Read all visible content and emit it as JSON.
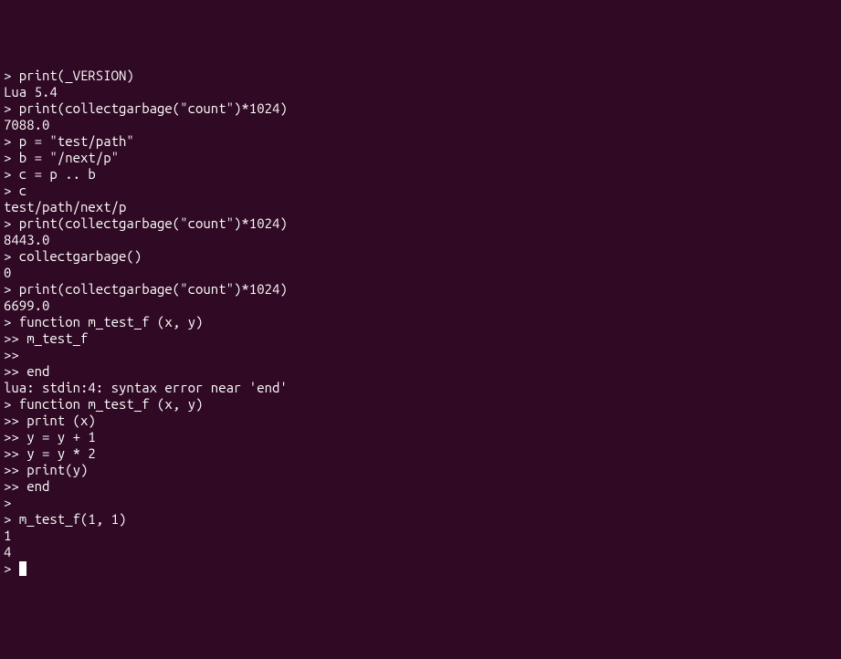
{
  "terminal": {
    "lines": [
      "> print(_VERSION)",
      "Lua 5.4",
      "> print(collectgarbage(\"count\")*1024)",
      "7088.0",
      "> p = \"test/path\"",
      "> b = \"/next/p\"",
      "> c = p .. b",
      "> c",
      "test/path/next/p",
      "> print(collectgarbage(\"count\")*1024)",
      "8443.0",
      "> collectgarbage()",
      "0",
      "> print(collectgarbage(\"count\")*1024)",
      "6699.0",
      "> function m_test_f (x, y)",
      ">> m_test_f",
      ">>",
      ">> end",
      "lua: stdin:4: syntax error near 'end'",
      "> function m_test_f (x, y)",
      ">> print (x)",
      ">> y = y + 1",
      ">> y = y * 2",
      ">> print(y)",
      ">> end",
      ">",
      "> m_test_f(1, 1)",
      "1",
      "4",
      "> "
    ]
  }
}
